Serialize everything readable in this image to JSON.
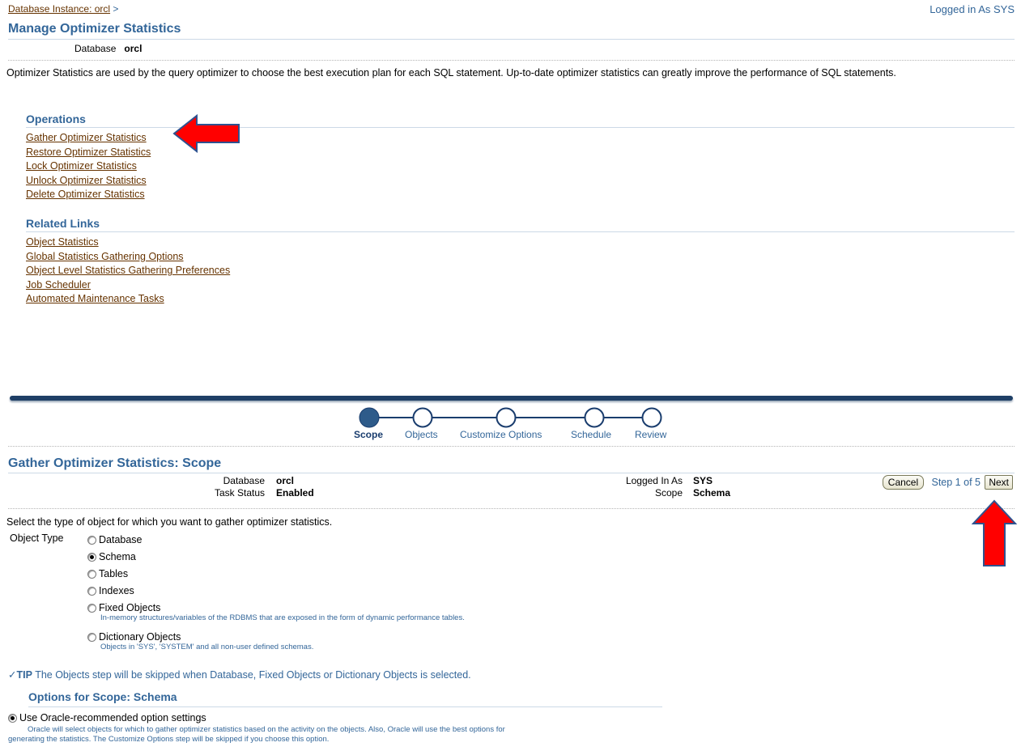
{
  "header": {
    "breadcrumb": "Database Instance: orcl",
    "breadcrumb_sep": ">",
    "logged_in": "Logged in As SYS",
    "title": "Manage Optimizer Statistics",
    "db_label": "Database",
    "db_value": "orcl"
  },
  "intro": "Optimizer Statistics are used by the query optimizer to choose the best execution plan for each SQL statement. Up-to-date optimizer statistics can greatly improve the performance of SQL statements.",
  "operations": {
    "heading": "Operations",
    "links": [
      "Gather Optimizer Statistics",
      "Restore Optimizer Statistics",
      "Lock Optimizer Statistics",
      "Unlock Optimizer Statistics",
      "Delete Optimizer Statistics"
    ]
  },
  "related": {
    "heading": "Related Links",
    "links": [
      "Object Statistics",
      "Global Statistics Gathering Options",
      "Object Level Statistics Gathering Preferences",
      "Job Scheduler",
      "Automated Maintenance Tasks"
    ]
  },
  "train": {
    "steps": [
      "Scope",
      "Objects",
      "Customize Options",
      "Schedule",
      "Review"
    ],
    "active": 0
  },
  "wizard": {
    "title": "Gather Optimizer Statistics: Scope",
    "database_label": "Database",
    "database_value": "orcl",
    "task_status_label": "Task Status",
    "task_status_value": "Enabled",
    "logged_label": "Logged In As",
    "logged_value": "SYS",
    "scope_label": "Scope",
    "scope_value": "Schema",
    "cancel": "Cancel",
    "step_text": "Step 1 of 5",
    "next": "Next",
    "instruction": "Select the type of object for which you want to gather optimizer statistics.",
    "object_type_label": "Object Type",
    "options": [
      {
        "label": "Database",
        "desc": "",
        "selected": false
      },
      {
        "label": "Schema",
        "desc": "",
        "selected": true
      },
      {
        "label": "Tables",
        "desc": "",
        "selected": false
      },
      {
        "label": "Indexes",
        "desc": "",
        "selected": false
      },
      {
        "label": "Fixed Objects",
        "desc": "In-memory structures/variables of the RDBMS that are exposed in the form of dynamic performance tables.",
        "selected": false
      },
      {
        "label": "Dictionary Objects",
        "desc": "Objects in 'SYS', 'SYSTEM' and all non-user defined schemas.",
        "selected": false
      }
    ],
    "tip_label": "TIP",
    "tip_text": "The Objects step will be skipped when Database, Fixed Objects or Dictionary Objects is selected.",
    "options_heading": "Options for Scope: Schema",
    "recommended_label": "Use Oracle-recommended option settings",
    "recommended_desc_1": "Oracle will select objects for which to gather optimizer statistics based on the activity on the objects. Also, Oracle will use the best options for",
    "recommended_desc_2": "generating the statistics. The Customize Options step will be skipped if you choose this option."
  },
  "colors": {
    "link": "#663300",
    "heading": "#336699",
    "arrow": "#ff0000",
    "arrow_outline": "#2f528f"
  }
}
